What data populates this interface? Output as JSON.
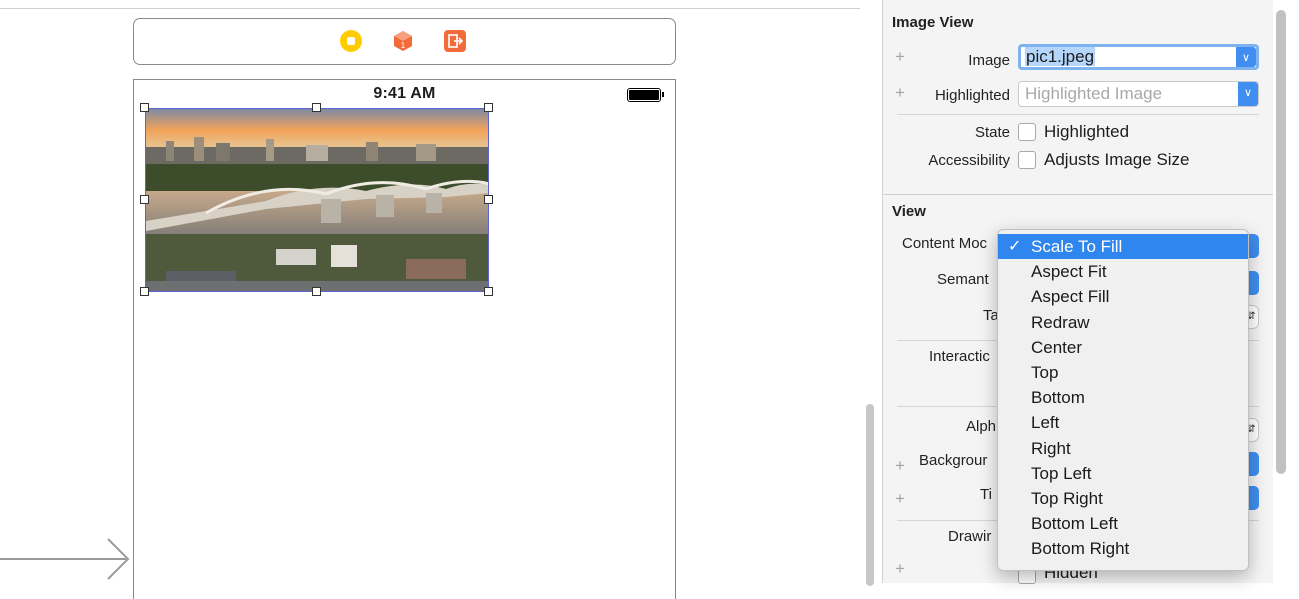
{
  "canvas": {
    "status_time": "9:41 AM",
    "image_alt": "pic1.jpeg"
  },
  "inspector": {
    "image_view": {
      "title": "Image View",
      "image_label": "Image",
      "image_value": "pic1.jpeg",
      "highlighted_label": "Highlighted",
      "highlighted_placeholder": "Highlighted Image",
      "state_label": "State",
      "state_checkbox": "Highlighted",
      "accessibility_label": "Accessibility",
      "accessibility_checkbox": "Adjusts Image Size"
    },
    "view": {
      "title": "View",
      "content_mode_label": "Content Moc",
      "semantic_label": "Semant",
      "tag_label": "Ta",
      "interaction_label": "Interactic",
      "alpha_label": "Alph",
      "background_label": "Backgrour",
      "tint_label": "Ti",
      "drawing_label": "Drawir",
      "hidden_label": "Hidden"
    }
  },
  "popup_menu": {
    "selected": "Scale To Fill",
    "items": [
      "Scale To Fill",
      "Aspect Fit",
      "Aspect Fill",
      "Redraw",
      "Center",
      "Top",
      "Bottom",
      "Left",
      "Right",
      "Top Left",
      "Top Right",
      "Bottom Left",
      "Bottom Right"
    ]
  },
  "colors": {
    "accent": "#3f8ef0",
    "selection_border": "#5b63d6",
    "sky": "#f2a35a"
  }
}
